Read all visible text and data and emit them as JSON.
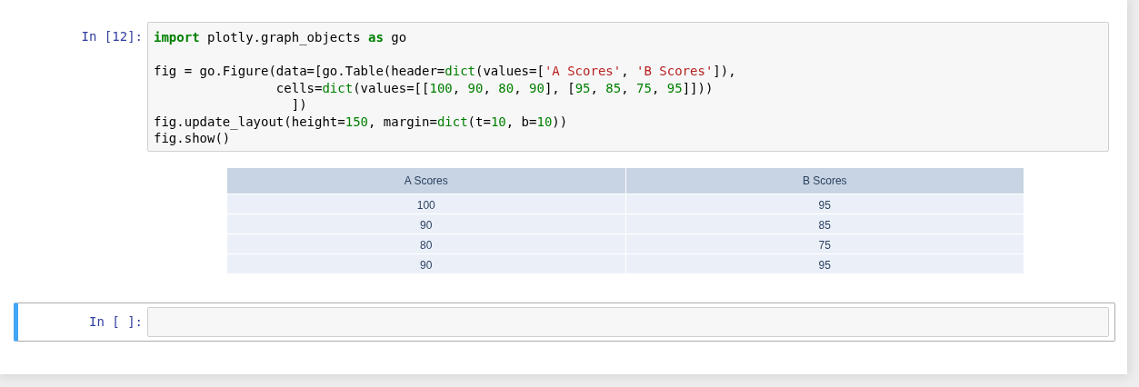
{
  "cells": [
    {
      "prompt": "In [12]:",
      "selected": false,
      "code_blocks": [
        [
          [
            {
              "kind": "keyword",
              "text": "import"
            },
            {
              "kind": "plain",
              "text": " plotly.graph_objects "
            },
            {
              "kind": "keyword",
              "text": "as"
            },
            {
              "kind": "plain",
              "text": " go"
            }
          ]
        ],
        [
          [
            {
              "kind": "plain",
              "text": "fig = go.Figure(data=[go.Table(header="
            },
            {
              "kind": "builtin",
              "text": "dict"
            },
            {
              "kind": "plain",
              "text": "(values=["
            },
            {
              "kind": "string",
              "text": "'A Scores'"
            },
            {
              "kind": "plain",
              "text": ", "
            },
            {
              "kind": "string",
              "text": "'B Scores'"
            },
            {
              "kind": "plain",
              "text": "]),"
            }
          ],
          [
            {
              "kind": "plain",
              "text": "                cells="
            },
            {
              "kind": "builtin",
              "text": "dict"
            },
            {
              "kind": "plain",
              "text": "(values=[["
            },
            {
              "kind": "number",
              "text": "100"
            },
            {
              "kind": "plain",
              "text": ", "
            },
            {
              "kind": "number",
              "text": "90"
            },
            {
              "kind": "plain",
              "text": ", "
            },
            {
              "kind": "number",
              "text": "80"
            },
            {
              "kind": "plain",
              "text": ", "
            },
            {
              "kind": "number",
              "text": "90"
            },
            {
              "kind": "plain",
              "text": "], ["
            },
            {
              "kind": "number",
              "text": "95"
            },
            {
              "kind": "plain",
              "text": ", "
            },
            {
              "kind": "number",
              "text": "85"
            },
            {
              "kind": "plain",
              "text": ", "
            },
            {
              "kind": "number",
              "text": "75"
            },
            {
              "kind": "plain",
              "text": ", "
            },
            {
              "kind": "number",
              "text": "95"
            },
            {
              "kind": "plain",
              "text": "]]))"
            }
          ],
          [
            {
              "kind": "plain",
              "text": "                  ])"
            }
          ],
          [
            {
              "kind": "plain",
              "text": "fig.update_layout(height="
            },
            {
              "kind": "number",
              "text": "150"
            },
            {
              "kind": "plain",
              "text": ", margin="
            },
            {
              "kind": "builtin",
              "text": "dict"
            },
            {
              "kind": "plain",
              "text": "(t="
            },
            {
              "kind": "number",
              "text": "10"
            },
            {
              "kind": "plain",
              "text": ", b="
            },
            {
              "kind": "number",
              "text": "10"
            },
            {
              "kind": "plain",
              "text": "))"
            }
          ],
          [
            {
              "kind": "plain",
              "text": "fig.show()"
            }
          ]
        ]
      ],
      "output": {
        "columns": [
          "A Scores",
          "B Scores"
        ],
        "rows": [
          [
            "100",
            "95"
          ],
          [
            "90",
            "85"
          ],
          [
            "80",
            "75"
          ],
          [
            "90",
            "95"
          ]
        ]
      }
    },
    {
      "prompt": "In [ ]:",
      "selected": true
    }
  ]
}
